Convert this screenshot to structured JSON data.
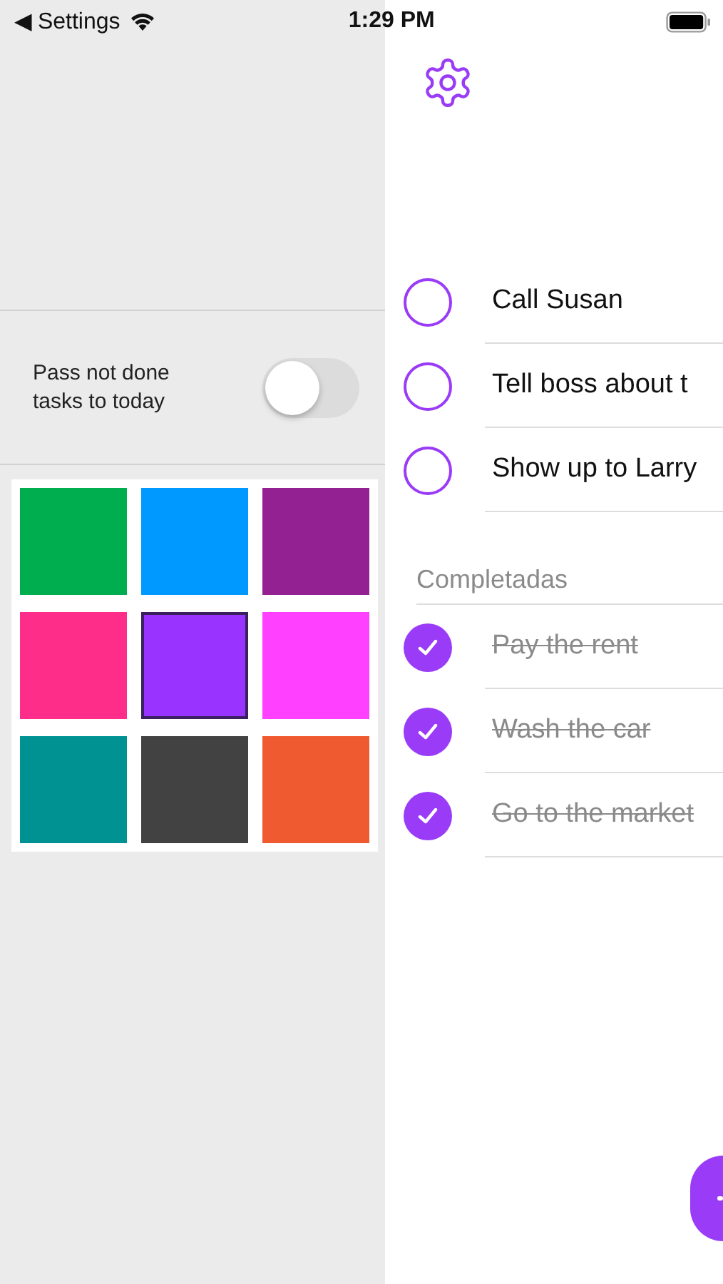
{
  "status_bar": {
    "back": "◀ Settings",
    "time": "1:29 PM"
  },
  "settings": {
    "toggle": {
      "label": "Pass not done tasks to today",
      "on": false
    },
    "swatches": [
      {
        "color": "#00ae4f",
        "selected": false
      },
      {
        "color": "#0099ff",
        "selected": false
      },
      {
        "color": "#942192",
        "selected": false
      },
      {
        "color": "#ff2d8a",
        "selected": false
      },
      {
        "color": "#9933ff",
        "selected": true
      },
      {
        "color": "#ff40ff",
        "selected": false
      },
      {
        "color": "#009192",
        "selected": false
      },
      {
        "color": "#424242",
        "selected": false
      },
      {
        "color": "#f05a30",
        "selected": false
      }
    ]
  },
  "tasks": [
    {
      "text": "Call Susan",
      "done": false
    },
    {
      "text": "Tell boss about t",
      "done": false
    },
    {
      "text": "Show up to Larry",
      "done": false
    }
  ],
  "completed": {
    "heading": "Completadas",
    "tasks": [
      {
        "text": "Pay the rent",
        "done": true
      },
      {
        "text": "Wash the car",
        "done": true
      },
      {
        "text": "Go to the market",
        "done": true
      }
    ]
  }
}
